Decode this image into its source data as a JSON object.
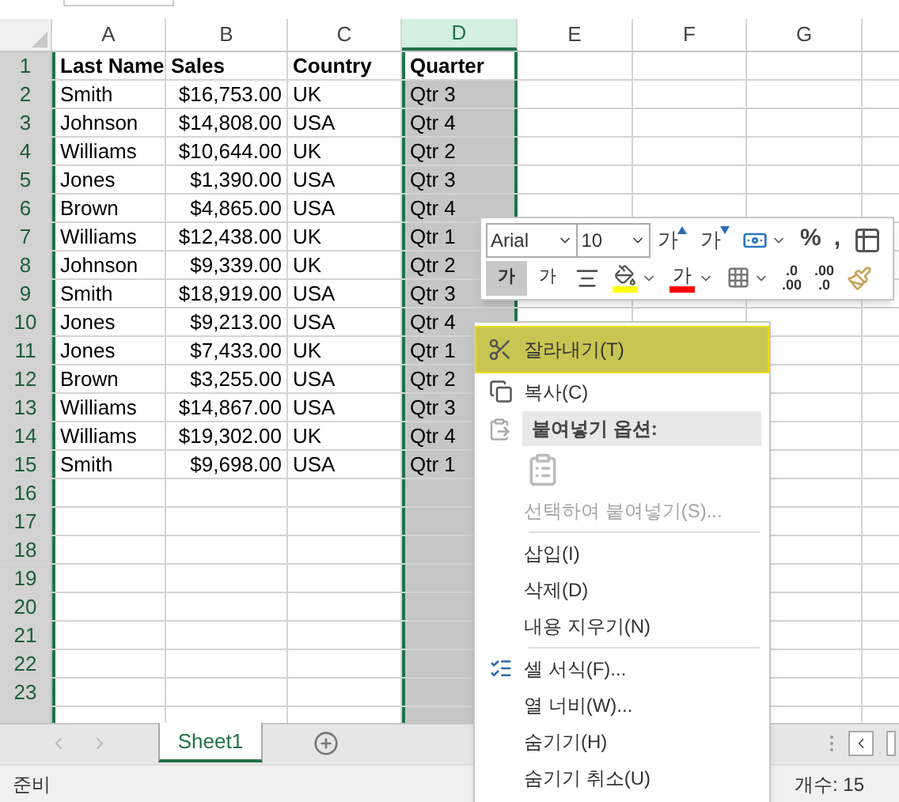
{
  "columns": [
    {
      "label": "A",
      "selected": false
    },
    {
      "label": "B",
      "selected": false
    },
    {
      "label": "C",
      "selected": false
    },
    {
      "label": "D",
      "selected": true
    },
    {
      "label": "E",
      "selected": false
    },
    {
      "label": "F",
      "selected": false
    },
    {
      "label": "G",
      "selected": false
    }
  ],
  "rows": [
    {
      "number": "1",
      "cells": [
        "Last Name",
        "Sales",
        "Country",
        "Quarter"
      ]
    },
    {
      "number": "2",
      "cells": [
        "Smith",
        "$16,753.00",
        "UK",
        "Qtr 3"
      ]
    },
    {
      "number": "3",
      "cells": [
        "Johnson",
        "$14,808.00",
        "USA",
        "Qtr 4"
      ]
    },
    {
      "number": "4",
      "cells": [
        "Williams",
        "$10,644.00",
        "UK",
        "Qtr 2"
      ]
    },
    {
      "number": "5",
      "cells": [
        "Jones",
        "$1,390.00",
        "USA",
        "Qtr 3"
      ]
    },
    {
      "number": "6",
      "cells": [
        "Brown",
        "$4,865.00",
        "USA",
        "Qtr 4"
      ]
    },
    {
      "number": "7",
      "cells": [
        "Williams",
        "$12,438.00",
        "UK",
        "Qtr 1"
      ]
    },
    {
      "number": "8",
      "cells": [
        "Johnson",
        "$9,339.00",
        "UK",
        "Qtr 2"
      ]
    },
    {
      "number": "9",
      "cells": [
        "Smith",
        "$18,919.00",
        "USA",
        "Qtr 3"
      ]
    },
    {
      "number": "10",
      "cells": [
        "Jones",
        "$9,213.00",
        "USA",
        "Qtr 4"
      ]
    },
    {
      "number": "11",
      "cells": [
        "Jones",
        "$7,433.00",
        "UK",
        "Qtr 1"
      ]
    },
    {
      "number": "12",
      "cells": [
        "Brown",
        "$3,255.00",
        "USA",
        "Qtr 2"
      ]
    },
    {
      "number": "13",
      "cells": [
        "Williams",
        "$14,867.00",
        "USA",
        "Qtr 3"
      ]
    },
    {
      "number": "14",
      "cells": [
        "Williams",
        "$19,302.00",
        "UK",
        "Qtr 4"
      ]
    },
    {
      "number": "15",
      "cells": [
        "Smith",
        "$9,698.00",
        "USA",
        "Qtr 1"
      ]
    },
    {
      "number": "16",
      "cells": []
    },
    {
      "number": "17",
      "cells": []
    },
    {
      "number": "18",
      "cells": []
    },
    {
      "number": "19",
      "cells": []
    },
    {
      "number": "20",
      "cells": []
    },
    {
      "number": "21",
      "cells": []
    },
    {
      "number": "22",
      "cells": []
    },
    {
      "number": "23",
      "cells": []
    }
  ],
  "mini_toolbar": {
    "font": "Arial",
    "size": "10",
    "row1": [
      {
        "kind": "grow",
        "label": "가"
      },
      {
        "kind": "shrink",
        "label": "가"
      },
      {
        "kind": "currency"
      },
      {
        "kind": "percent",
        "label": "%"
      },
      {
        "kind": "comma",
        "label": ","
      },
      {
        "kind": "wrap"
      }
    ],
    "row2": [
      {
        "kind": "bold",
        "label": "가",
        "selected": true
      },
      {
        "kind": "italic",
        "label": "가",
        "selected": false
      },
      {
        "kind": "align"
      },
      {
        "kind": "fill",
        "color": "#ffff00"
      },
      {
        "kind": "font_color",
        "label": "가",
        "color": "#ff0000"
      },
      {
        "kind": "borders"
      },
      {
        "kind": "inc_decimal",
        "top": ".0",
        "bottom": ".00"
      },
      {
        "kind": "dec_decimal",
        "top": ".00",
        "bottom": ".0"
      },
      {
        "kind": "painter"
      }
    ]
  },
  "context_menu": [
    {
      "kind": "cut",
      "label": "잘라내기(T)",
      "highlighted": true,
      "disabled": false
    },
    {
      "kind": "copy",
      "label": "복사(C)",
      "highlighted": false,
      "disabled": false
    },
    {
      "kind": "header",
      "label": "붙여넣기 옵션:"
    },
    {
      "kind": "paste_option"
    },
    {
      "kind": "item",
      "label": "선택하여 붙여넣기(S)...",
      "highlighted": false,
      "disabled": true
    },
    {
      "kind": "separator"
    },
    {
      "kind": "item",
      "label": "삽입(I)",
      "highlighted": false,
      "disabled": false
    },
    {
      "kind": "item",
      "label": "삭제(D)",
      "highlighted": false,
      "disabled": false
    },
    {
      "kind": "item",
      "label": "내용 지우기(N)",
      "highlighted": false,
      "disabled": false
    },
    {
      "kind": "separator"
    },
    {
      "kind": "format",
      "label": "셀 서식(F)...",
      "highlighted": false,
      "disabled": false
    },
    {
      "kind": "item",
      "label": "열 너비(W)...",
      "highlighted": false,
      "disabled": false
    },
    {
      "kind": "item",
      "label": "숨기기(H)",
      "highlighted": false,
      "disabled": false
    },
    {
      "kind": "item",
      "label": "숨기기 취소(U)",
      "highlighted": false,
      "disabled": false
    }
  ],
  "sheet_tabs": [
    {
      "label": "Sheet1",
      "selected": true
    }
  ],
  "status_bar": {
    "mode": "준비",
    "count": "개수: 15"
  }
}
